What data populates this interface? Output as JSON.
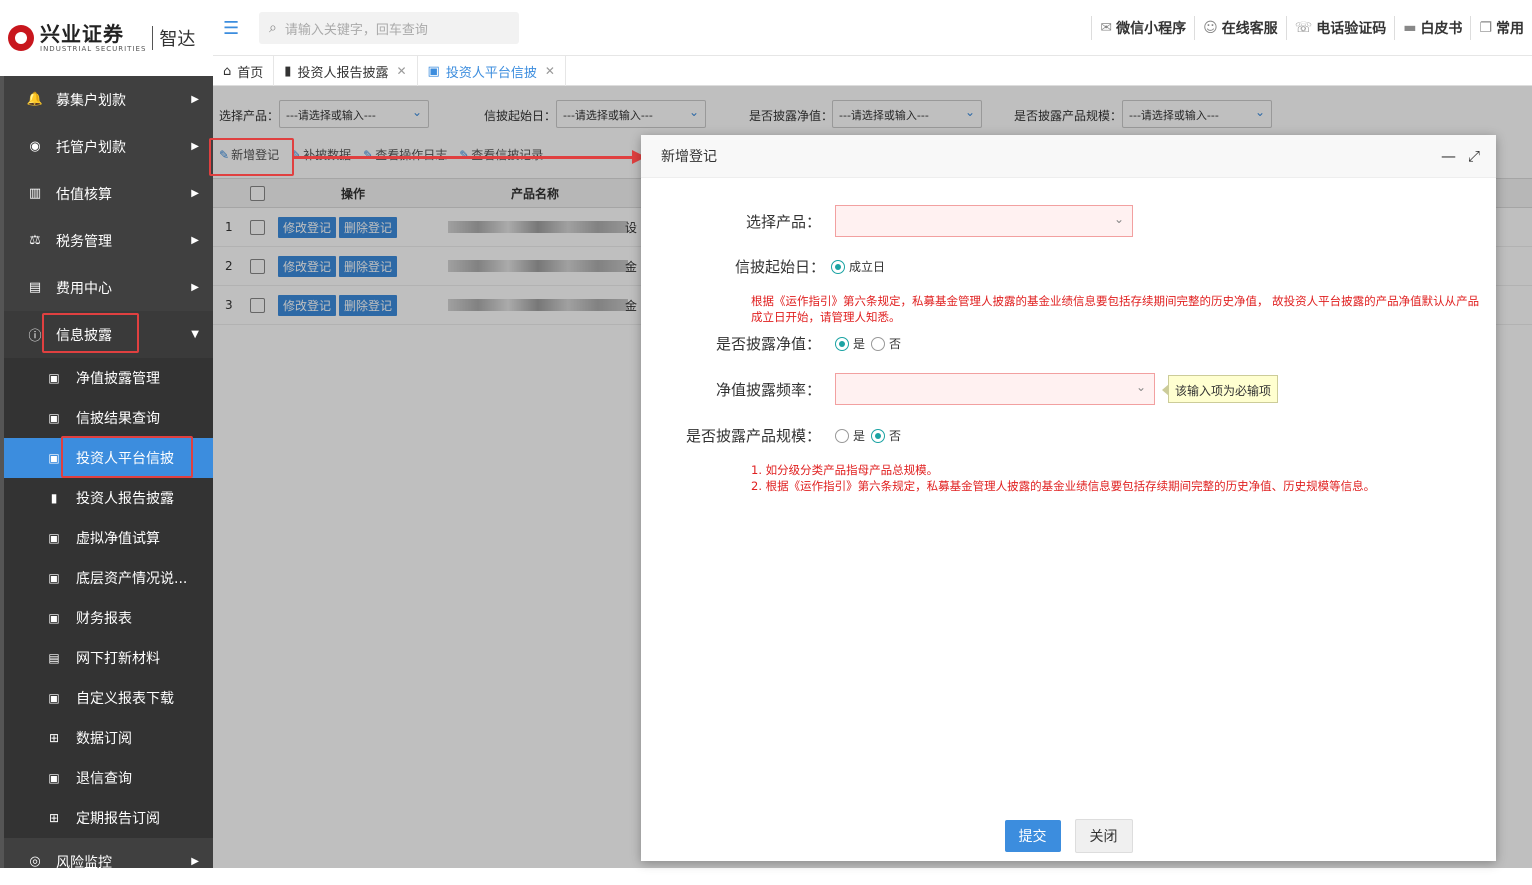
{
  "brand": {
    "name": "兴业证券",
    "en": "INDUSTRIAL SECURITIES",
    "product": "智达"
  },
  "search": {
    "placeholder": "请输入关键字，回车查询"
  },
  "top_links": [
    {
      "label": "微信小程序",
      "icon": "wechat-icon"
    },
    {
      "label": "在线客服",
      "icon": "headset-icon"
    },
    {
      "label": "电话验证码",
      "icon": "phone-icon"
    },
    {
      "label": "白皮书",
      "icon": "book-icon"
    },
    {
      "label": "常用",
      "icon": "copy-icon"
    }
  ],
  "tabs": [
    {
      "label": "首页",
      "icon": "home-icon"
    },
    {
      "label": "投资人报告披露",
      "icon": "file-icon"
    },
    {
      "label": "投资人平台信披",
      "icon": "image-icon"
    }
  ],
  "menu": {
    "top": [
      {
        "label": "募集户划款",
        "icon": "bell-icon"
      },
      {
        "label": "托管户划款",
        "icon": "target-icon"
      },
      {
        "label": "估值核算",
        "icon": "bar-chart-icon"
      },
      {
        "label": "税务管理",
        "icon": "scale-icon"
      },
      {
        "label": "费用中心",
        "icon": "doc-icon"
      },
      {
        "label": "信息披露",
        "icon": "info-icon"
      }
    ],
    "sub": [
      {
        "label": "净值披露管理"
      },
      {
        "label": "信披结果查询"
      },
      {
        "label": "投资人平台信披"
      },
      {
        "label": "投资人报告披露"
      },
      {
        "label": "虚拟净值试算"
      },
      {
        "label": "底层资产情况说..."
      },
      {
        "label": "财务报表"
      },
      {
        "label": "网下打新材料"
      },
      {
        "label": "自定义报表下载"
      },
      {
        "label": "数据订阅"
      },
      {
        "label": "退信查询"
      },
      {
        "label": "定期报告订阅"
      }
    ],
    "bottom": {
      "label": "风险监控"
    }
  },
  "filters": {
    "product_label": "选择产品：",
    "start_label": "信披起始日：",
    "nav_label": "是否披露净值：",
    "scale_label": "是否披露产品规模：",
    "placeholder": "---请选择或输入---"
  },
  "actions": {
    "add": "新增登记",
    "supplement": "补披数据",
    "log": "查看操作日志",
    "record": "查看信披记录"
  },
  "grid": {
    "headers": {
      "op": "操作",
      "name": "产品名称"
    },
    "edit": "修改登记",
    "delete": "删除登记",
    "rows": [
      {
        "idx": "1",
        "tail": "设"
      },
      {
        "idx": "2",
        "tail": "金"
      },
      {
        "idx": "3",
        "tail": "金"
      }
    ]
  },
  "dialog": {
    "title": "新增登记",
    "product_label": "选择产品：",
    "start_label": "信披起始日：",
    "start_option": "成立日",
    "note1": "根据《运作指引》第六条规定，私募基金管理人披露的基金业绩信息要包括存续期间完整的历史净值， 故投资人平台披露的产品净值默认从产品成立日开始，请管理人知悉。",
    "nav_label": "是否披露净值：",
    "yes": "是",
    "no": "否",
    "freq_label": "净值披露频率：",
    "required_tip": "该输入项为必输项",
    "scale_label": "是否披露产品规模：",
    "note2_1": "1. 如分级分类产品指母产品总规模。",
    "note2_2": "2. 根据《运作指引》第六条规定，私募基金管理人披露的基金业绩信息要包括存续期间完整的历史净值、历史规模等信息。",
    "submit": "提交",
    "close": "关闭"
  }
}
